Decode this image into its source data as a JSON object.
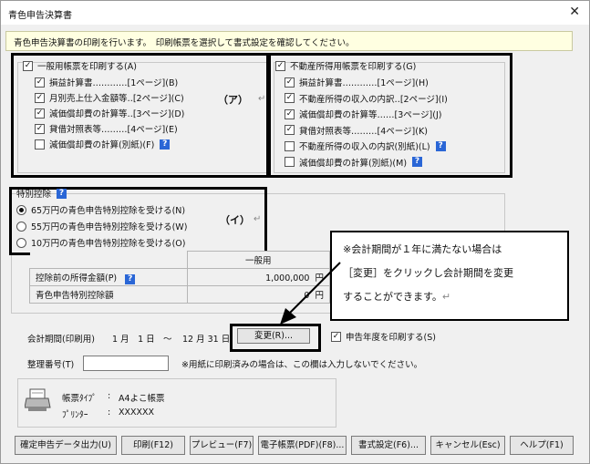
{
  "window": {
    "title": "青色申告決算書",
    "close_glyph": "✕"
  },
  "info": "青色申告決算書の印刷を行います。　印刷帳票を選択して書式設定を確認してください。",
  "general": {
    "master": "一般用帳票を印刷する(A)",
    "items": [
      {
        "label": "損益計算書…………[1ページ](B)",
        "checked": true
      },
      {
        "label": "月別売上仕入金額等‥[2ページ](C)",
        "checked": true
      },
      {
        "label": "減価償却費の計算等‥[3ページ](D)",
        "checked": true
      },
      {
        "label": "貸借対照表等………[4ページ](E)",
        "checked": true
      },
      {
        "label": "減価償却費の計算(別紙)(F)",
        "checked": false
      }
    ],
    "marker": "（ア）"
  },
  "realestate": {
    "master": "不動産所得用帳票を印刷する(G)",
    "items": [
      {
        "label": "損益計算書…………[1ページ](H)",
        "checked": true
      },
      {
        "label": "不動産所得の収入の内訳‥[2ページ](I)",
        "checked": true
      },
      {
        "label": "減価償却費の計算等……[3ページ](J)",
        "checked": true
      },
      {
        "label": "貸借対照表等………[4ページ](K)",
        "checked": true
      },
      {
        "label": "不動産所得の収入の内訳(別紙)(L)",
        "checked": false
      },
      {
        "label": "減価償却費の計算(別紙)(M)",
        "checked": false
      }
    ]
  },
  "special": {
    "title": "特別控除",
    "options": [
      {
        "label": "65万円の青色申告特別控除を受ける(N)",
        "selected": true
      },
      {
        "label": "55万円の青色申告特別控除を受ける(W)",
        "selected": false
      },
      {
        "label": "10万円の青色申告特別控除を受ける(O)",
        "selected": false
      }
    ],
    "marker": "（イ）"
  },
  "amounts": {
    "column_header": "一般用",
    "row1_label": "控除前の所得金額(P)",
    "row1_value": "1,000,000",
    "row1_unit": "円",
    "row2_label": "青色申告特別控除額",
    "row2_value": "0",
    "row2_unit": "円"
  },
  "callout": {
    "line1": "※会計期間が１年に満たない場合は",
    "line2": "［変更］をクリックし会計期間を変更",
    "line3": "することができます。"
  },
  "period": {
    "label": "会計期間(印刷用)",
    "start": "1 月　1 日",
    "tilde": "～",
    "end": "12 月 31 日",
    "change_button": "変更(R)...",
    "print_year": "申告年度を印刷する(S)"
  },
  "seiri": {
    "label": "整理番号(T)",
    "value": "",
    "note": "※用紙に印刷済みの場合は、この欄は入力しないでください。"
  },
  "printer": {
    "type_label": "帳票ﾀｲﾌﾟ",
    "type_value": "A4よこ帳票",
    "printer_label": "ﾌﾟﾘﾝﾀｰ",
    "printer_value": "XXXXXX",
    "sep": ":"
  },
  "buttons": [
    "確定申告データ出力(U)",
    "印刷(F12)",
    "プレビュー(F7)",
    "電子帳票(PDF)(F8)...",
    "書式設定(F6)...",
    "キャンセル(Esc)",
    "ヘルプ(F1)"
  ],
  "enter_mark": "↵",
  "help_glyph": "?",
  "check_glyph": "✓"
}
